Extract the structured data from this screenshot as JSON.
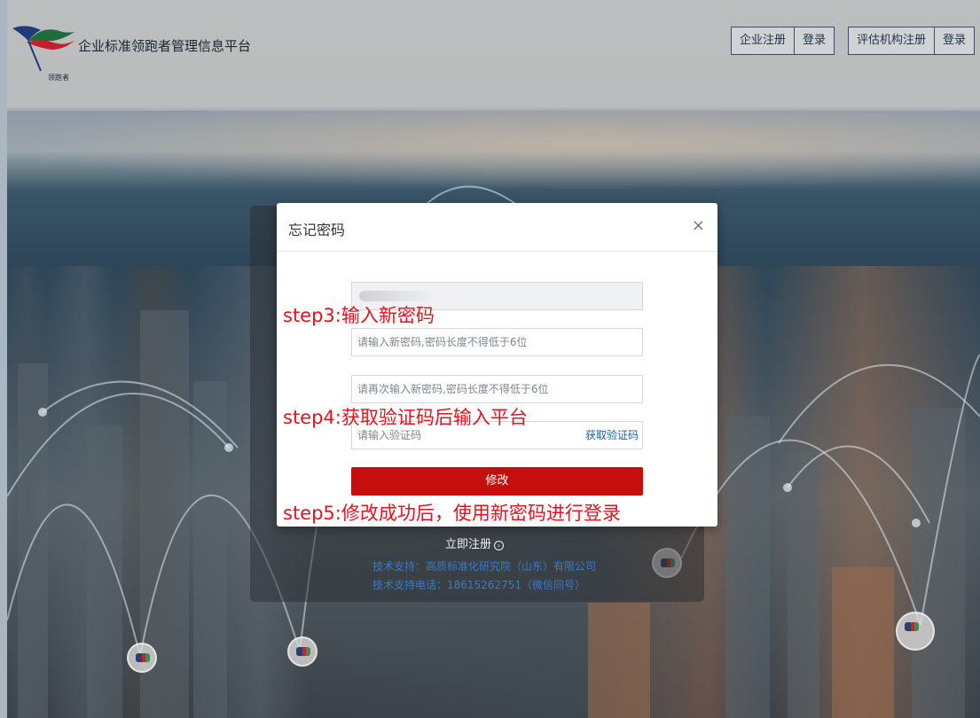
{
  "header": {
    "logo_caption": "领跑者",
    "site_title": "企业标准领跑者管理信息平台",
    "nav_enterprise": {
      "register": "企业注册",
      "login": "登录"
    },
    "nav_agency": {
      "register": "评估机构注册",
      "login": "登录"
    }
  },
  "background_card": {
    "register_link": "立即注册",
    "support_line_1": "技术支持：高质标准化研究院（山东）有限公司",
    "support_line_2": "技术支持电话：18615262751（微信同号）"
  },
  "modal": {
    "title": "忘记密码",
    "close_symbol": "×",
    "fields": {
      "new_password_placeholder": "请输入新密码,密码长度不得低于6位",
      "confirm_password_placeholder": "请再次输入新密码,密码长度不得低于6位",
      "verification_code_placeholder": "请输入验证码",
      "get_code_label": "获取验证码"
    },
    "submit_label": "修改"
  },
  "annotations": {
    "step3": "step3:输入新密码",
    "step4": "step4:获取验证码后输入平台",
    "step5": "step5:修改成功后，使用新密码进行登录"
  },
  "colors": {
    "primary_button": "#c50f0f",
    "annotation_text": "#e8121f",
    "link_blue": "#1f5ea8",
    "support_text": "#3a7ac4"
  },
  "icons": {
    "close": "close-icon",
    "register_arrow": "circle-arrow-right-icon",
    "logo": "flag-logo-icon",
    "badge": "map-marker-badge-icon"
  }
}
